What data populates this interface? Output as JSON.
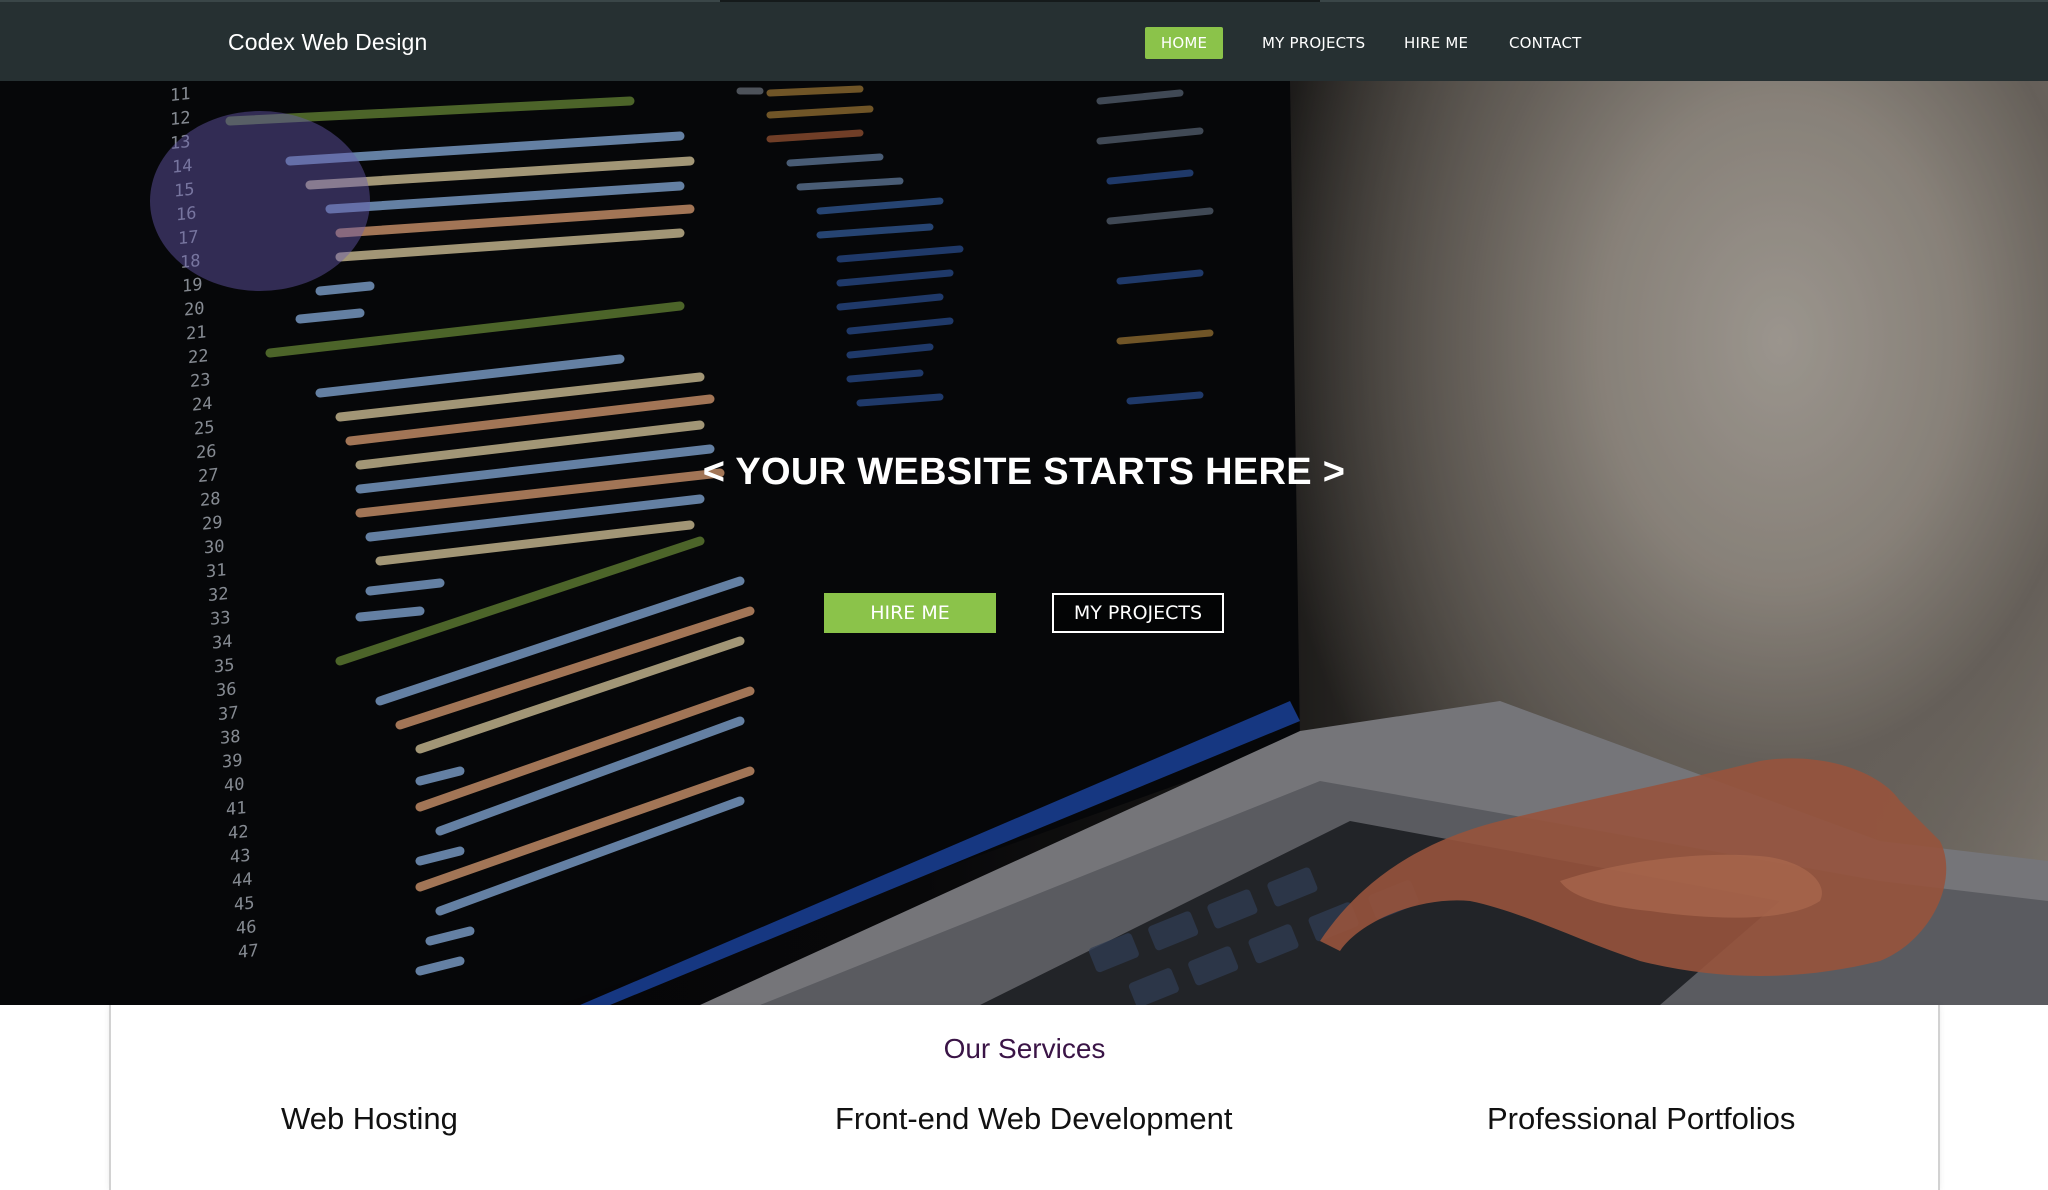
{
  "navbar": {
    "brand": "Codex Web Design",
    "links": [
      {
        "label": "HOME",
        "active": true
      },
      {
        "label": "MY PROJECTS",
        "active": false
      },
      {
        "label": "HIRE ME",
        "active": false
      },
      {
        "label": "CONTACT",
        "active": false
      }
    ]
  },
  "hero": {
    "title": "< YOUR WEBSITE STARTS HERE >",
    "buttons": {
      "hire_label": "HIRE ME",
      "projects_label": "MY PROJECTS"
    }
  },
  "services": {
    "title": "Our Services",
    "items": [
      "Web Hosting",
      "Front-end Web Development",
      "Professional Portfolios"
    ]
  },
  "colors": {
    "accent": "#8bc34a",
    "navbar_bg": "#263032",
    "services_title": "#3a1446"
  }
}
